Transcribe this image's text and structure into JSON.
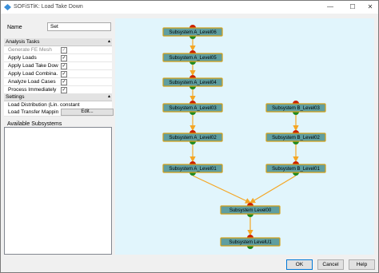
{
  "window": {
    "title": "SOFiSTiK: Load Take Down",
    "minimize": "—",
    "maximize": "☐",
    "close": "✕"
  },
  "name_field": {
    "label": "Name",
    "value": "Set"
  },
  "analysis_tasks": {
    "header": "Analysis Tasks",
    "items": [
      {
        "label": "Generate FE Mesh",
        "checked": "✓",
        "disabled": true
      },
      {
        "label": "Apply Loads",
        "checked": "✓",
        "disabled": false
      },
      {
        "label": "Apply Load Take Down",
        "checked": "✓",
        "disabled": false
      },
      {
        "label": "Apply Load Combina…",
        "checked": "✓",
        "disabled": false
      },
      {
        "label": "Analyze Load Cases",
        "checked": "✓",
        "disabled": false
      },
      {
        "label": "Process Immediately",
        "checked": "✓",
        "disabled": false
      }
    ]
  },
  "settings": {
    "header": "Settings",
    "load_distribution": {
      "label": "Load Distribution (Lin…",
      "value": "constant"
    },
    "load_transfer_mapping": {
      "label": "Load Transfer Mapping",
      "button": "Edit..."
    }
  },
  "available_subsystems": {
    "label": "Available Subsystems",
    "items": []
  },
  "graph": {
    "nodes": [
      {
        "id": "a06",
        "label": "Subsystem A_Level06"
      },
      {
        "id": "a05",
        "label": "Subsystem A_Level05"
      },
      {
        "id": "a04",
        "label": "Subsystem A_Level04"
      },
      {
        "id": "a03",
        "label": "Subsystem A_Level03"
      },
      {
        "id": "a02",
        "label": "Subsystem A_Level02"
      },
      {
        "id": "a01",
        "label": "Subsystem A_Level01"
      },
      {
        "id": "b03",
        "label": "Subsystem B_Level03"
      },
      {
        "id": "b02",
        "label": "Subsystem B_Level02"
      },
      {
        "id": "b01",
        "label": "Subsystem B_Level01"
      },
      {
        "id": "l00",
        "label": "Subsystem Level00"
      },
      {
        "id": "u01",
        "label": "Subsystem LevelU1"
      }
    ],
    "edges": [
      [
        "a06",
        "a05"
      ],
      [
        "a05",
        "a04"
      ],
      [
        "a04",
        "a03"
      ],
      [
        "a03",
        "a02"
      ],
      [
        "a02",
        "a01"
      ],
      [
        "b03",
        "b02"
      ],
      [
        "b02",
        "b01"
      ],
      [
        "a01",
        "l00"
      ],
      [
        "b01",
        "l00"
      ],
      [
        "l00",
        "u01"
      ]
    ],
    "colors": {
      "node_fill": "#5f9ea0",
      "node_border": "#d4a017",
      "top_port": "#cc2200",
      "bottom_port": "#1f8a1f",
      "edge": "#f5a623"
    }
  },
  "buttons": {
    "ok": "OK",
    "cancel": "Cancel",
    "help": "Help"
  }
}
